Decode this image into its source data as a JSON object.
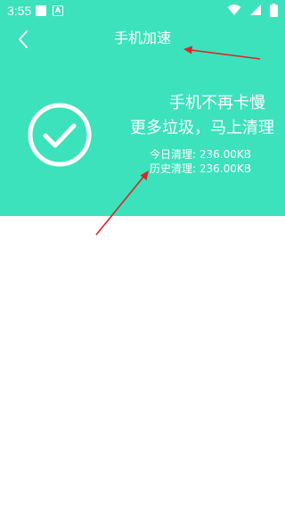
{
  "status_bar": {
    "time": "3:55",
    "notification_icons": [
      "square-notification-icon",
      "a-notification-icon"
    ],
    "system_icons": [
      "wifi-icon",
      "signal-icon",
      "battery-icon"
    ]
  },
  "header": {
    "back_icon": "chevron-left-icon",
    "title": "手机加速"
  },
  "result": {
    "status_icon": "check-circle-icon",
    "headline_line1": "手机不再卡慢",
    "headline_line2": "更多垃圾，马上清理",
    "today_label": "今日清理: ",
    "today_value": "236.00KB",
    "history_label": "历史清理: ",
    "history_value": "236.00KB"
  },
  "colors": {
    "accent": "#3ce2bb",
    "annotation_arrow": "#d9262a",
    "background": "#ffffff"
  }
}
